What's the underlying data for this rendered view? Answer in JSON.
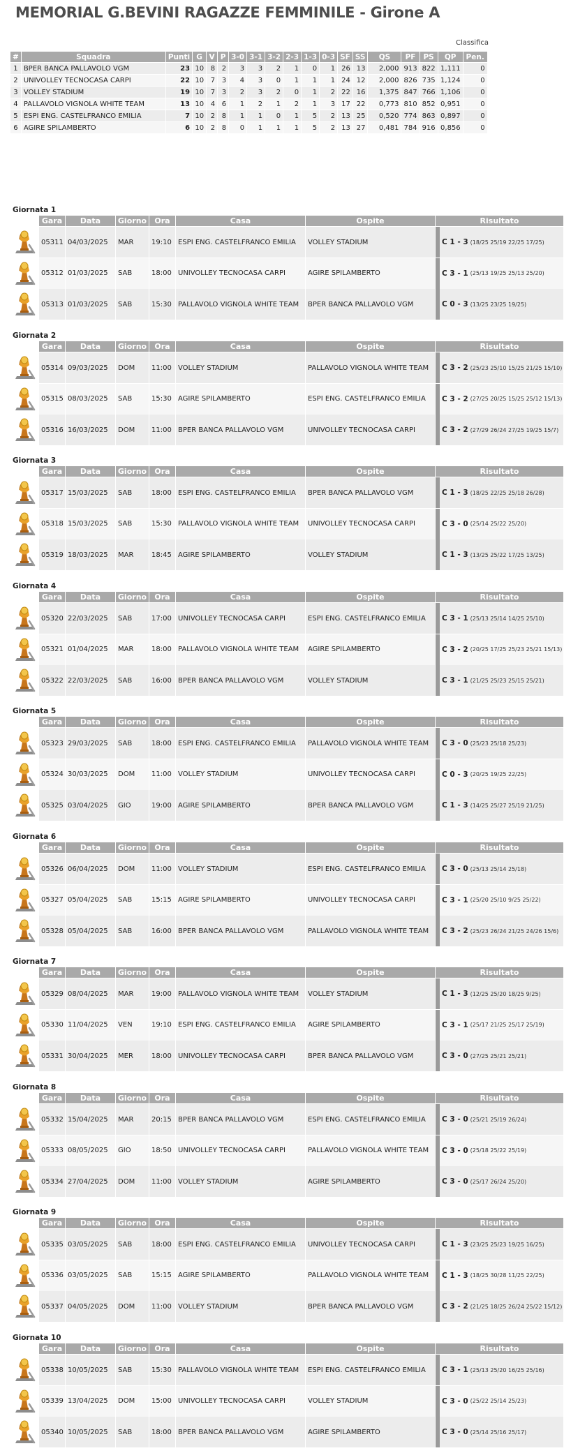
{
  "title": "MEMORIAL G.BEVINI RAGAZZE FEMMINILE - Girone A",
  "classifica": {
    "caption": "Classifica",
    "headers": [
      "#",
      "Squadra",
      "Punti",
      "G",
      "V",
      "P",
      "3-0",
      "3-1",
      "3-2",
      "2-3",
      "1-3",
      "0-3",
      "SF",
      "SS",
      "QS",
      "PF",
      "PS",
      "QP",
      "Pen."
    ],
    "rows": [
      [
        "1",
        "BPER BANCA PALLAVOLO VGM",
        "23",
        "10",
        "8",
        "2",
        "3",
        "3",
        "2",
        "1",
        "0",
        "1",
        "26",
        "13",
        "2,000",
        "913",
        "822",
        "1,111",
        "0"
      ],
      [
        "2",
        "UNIVOLLEY TECNOCASA CARPI",
        "22",
        "10",
        "7",
        "3",
        "4",
        "3",
        "0",
        "1",
        "1",
        "1",
        "24",
        "12",
        "2,000",
        "826",
        "735",
        "1,124",
        "0"
      ],
      [
        "3",
        "VOLLEY STADIUM",
        "19",
        "10",
        "7",
        "3",
        "2",
        "3",
        "2",
        "0",
        "1",
        "2",
        "22",
        "16",
        "1,375",
        "847",
        "766",
        "1,106",
        "0"
      ],
      [
        "4",
        "PALLAVOLO VIGNOLA WHITE TEAM",
        "13",
        "10",
        "4",
        "6",
        "1",
        "2",
        "1",
        "2",
        "1",
        "3",
        "17",
        "22",
        "0,773",
        "810",
        "852",
        "0,951",
        "0"
      ],
      [
        "5",
        "ESPI ENG. CASTELFRANCO EMILIA",
        "7",
        "10",
        "2",
        "8",
        "1",
        "1",
        "0",
        "1",
        "5",
        "2",
        "13",
        "25",
        "0,520",
        "774",
        "863",
        "0,897",
        "0"
      ],
      [
        "6",
        "AGIRE SPILAMBERTO",
        "6",
        "10",
        "2",
        "8",
        "0",
        "1",
        "1",
        "1",
        "5",
        "2",
        "13",
        "27",
        "0,481",
        "784",
        "916",
        "0,856",
        "0"
      ]
    ]
  },
  "round_headers": {
    "gara": "Gara",
    "data": "Data",
    "giorno": "Giorno",
    "ora": "Ora",
    "casa": "Casa",
    "ospite": "Ospite",
    "risultato": "Risultato"
  },
  "rounds": [
    {
      "title": "Giornata 1",
      "matches": [
        {
          "icon": "volleyball-trophy-icon",
          "gara": "05311",
          "data": "04/03/2025",
          "giorno": "MAR",
          "ora": "19:10",
          "casa": "ESPI ENG. CASTELFRANCO EMILIA",
          "ospite": "VOLLEY STADIUM",
          "score": "C 1 - 3",
          "sets": "(18/25 25/19 22/25 17/25)"
        },
        {
          "icon": "volleyball-trophy-icon",
          "gara": "05312",
          "data": "01/03/2025",
          "giorno": "SAB",
          "ora": "18:00",
          "casa": "UNIVOLLEY TECNOCASA CARPI",
          "ospite": "AGIRE SPILAMBERTO",
          "score": "C 3 - 1",
          "sets": "(25/13 19/25 25/13 25/20)"
        },
        {
          "icon": "volleyball-trophy-icon",
          "gara": "05313",
          "data": "01/03/2025",
          "giorno": "SAB",
          "ora": "15:30",
          "casa": "PALLAVOLO VIGNOLA WHITE TEAM",
          "ospite": "BPER BANCA PALLAVOLO VGM",
          "score": "C 0 - 3",
          "sets": "(13/25 23/25 19/25)"
        }
      ]
    },
    {
      "title": "Giornata 2",
      "matches": [
        {
          "icon": "volleyball-trophy-icon",
          "gara": "05314",
          "data": "09/03/2025",
          "giorno": "DOM",
          "ora": "11:00",
          "casa": "VOLLEY STADIUM",
          "ospite": "PALLAVOLO VIGNOLA WHITE TEAM",
          "score": "C 3 - 2",
          "sets": "(25/23 25/10 15/25 21/25 15/10)"
        },
        {
          "icon": "volleyball-trophy-icon",
          "gara": "05315",
          "data": "08/03/2025",
          "giorno": "SAB",
          "ora": "15:30",
          "casa": "AGIRE SPILAMBERTO",
          "ospite": "ESPI ENG. CASTELFRANCO EMILIA",
          "score": "C 3 - 2",
          "sets": "(27/25 20/25 15/25 25/12 15/13)"
        },
        {
          "icon": "volleyball-trophy-icon",
          "gara": "05316",
          "data": "16/03/2025",
          "giorno": "DOM",
          "ora": "11:00",
          "casa": "BPER BANCA PALLAVOLO VGM",
          "ospite": "UNIVOLLEY TECNOCASA CARPI",
          "score": "C 3 - 2",
          "sets": "(27/29 26/24 27/25 19/25 15/7)"
        }
      ]
    },
    {
      "title": "Giornata 3",
      "matches": [
        {
          "icon": "volleyball-trophy-icon",
          "gara": "05317",
          "data": "15/03/2025",
          "giorno": "SAB",
          "ora": "18:00",
          "casa": "ESPI ENG. CASTELFRANCO EMILIA",
          "ospite": "BPER BANCA PALLAVOLO VGM",
          "score": "C 1 - 3",
          "sets": "(18/25 22/25 25/18 26/28)"
        },
        {
          "icon": "volleyball-trophy-icon",
          "gara": "05318",
          "data": "15/03/2025",
          "giorno": "SAB",
          "ora": "15:30",
          "casa": "PALLAVOLO VIGNOLA WHITE TEAM",
          "ospite": "UNIVOLLEY TECNOCASA CARPI",
          "score": "C 3 - 0",
          "sets": "(25/14 25/22 25/20)"
        },
        {
          "icon": "volleyball-trophy-icon",
          "gara": "05319",
          "data": "18/03/2025",
          "giorno": "MAR",
          "ora": "18:45",
          "casa": "AGIRE SPILAMBERTO",
          "ospite": "VOLLEY STADIUM",
          "score": "C 1 - 3",
          "sets": "(13/25 25/22 17/25 13/25)"
        }
      ]
    },
    {
      "title": "Giornata 4",
      "matches": [
        {
          "icon": "volleyball-trophy-icon",
          "gara": "05320",
          "data": "22/03/2025",
          "giorno": "SAB",
          "ora": "17:00",
          "casa": "UNIVOLLEY TECNOCASA CARPI",
          "ospite": "ESPI ENG. CASTELFRANCO EMILIA",
          "score": "C 3 - 1",
          "sets": "(25/13 25/14 14/25 25/10)"
        },
        {
          "icon": "volleyball-trophy-icon",
          "gara": "05321",
          "data": "01/04/2025",
          "giorno": "MAR",
          "ora": "18:00",
          "casa": "PALLAVOLO VIGNOLA WHITE TEAM",
          "ospite": "AGIRE SPILAMBERTO",
          "score": "C 3 - 2",
          "sets": "(20/25 17/25 25/23 25/21 15/13)"
        },
        {
          "icon": "volleyball-trophy-icon",
          "gara": "05322",
          "data": "22/03/2025",
          "giorno": "SAB",
          "ora": "16:00",
          "casa": "BPER BANCA PALLAVOLO VGM",
          "ospite": "VOLLEY STADIUM",
          "score": "C 3 - 1",
          "sets": "(21/25 25/23 25/15 25/21)"
        }
      ]
    },
    {
      "title": "Giornata 5",
      "matches": [
        {
          "icon": "volleyball-trophy-icon",
          "gara": "05323",
          "data": "29/03/2025",
          "giorno": "SAB",
          "ora": "18:00",
          "casa": "ESPI ENG. CASTELFRANCO EMILIA",
          "ospite": "PALLAVOLO VIGNOLA WHITE TEAM",
          "score": "C 3 - 0",
          "sets": "(25/23 25/18 25/23)"
        },
        {
          "icon": "volleyball-trophy-icon",
          "gara": "05324",
          "data": "30/03/2025",
          "giorno": "DOM",
          "ora": "11:00",
          "casa": "VOLLEY STADIUM",
          "ospite": "UNIVOLLEY TECNOCASA CARPI",
          "score": "C 0 - 3",
          "sets": "(20/25 19/25 22/25)"
        },
        {
          "icon": "volleyball-trophy-icon",
          "gara": "05325",
          "data": "03/04/2025",
          "giorno": "GIO",
          "ora": "19:00",
          "casa": "AGIRE SPILAMBERTO",
          "ospite": "BPER BANCA PALLAVOLO VGM",
          "score": "C 1 - 3",
          "sets": "(14/25 25/27 25/19 21/25)"
        }
      ]
    },
    {
      "title": "Giornata 6",
      "matches": [
        {
          "icon": "volleyball-trophy-icon",
          "gara": "05326",
          "data": "06/04/2025",
          "giorno": "DOM",
          "ora": "11:00",
          "casa": "VOLLEY STADIUM",
          "ospite": "ESPI ENG. CASTELFRANCO EMILIA",
          "score": "C 3 - 0",
          "sets": "(25/13 25/14 25/18)"
        },
        {
          "icon": "volleyball-trophy-icon",
          "gara": "05327",
          "data": "05/04/2025",
          "giorno": "SAB",
          "ora": "15:15",
          "casa": "AGIRE SPILAMBERTO",
          "ospite": "UNIVOLLEY TECNOCASA CARPI",
          "score": "C 3 - 1",
          "sets": "(25/20 25/10 9/25 25/22)"
        },
        {
          "icon": "volleyball-trophy-icon",
          "gara": "05328",
          "data": "05/04/2025",
          "giorno": "SAB",
          "ora": "16:00",
          "casa": "BPER BANCA PALLAVOLO VGM",
          "ospite": "PALLAVOLO VIGNOLA WHITE TEAM",
          "score": "C 3 - 2",
          "sets": "(25/23 26/24 21/25 24/26 15/6)"
        }
      ]
    },
    {
      "title": "Giornata 7",
      "matches": [
        {
          "icon": "volleyball-trophy-icon",
          "gara": "05329",
          "data": "08/04/2025",
          "giorno": "MAR",
          "ora": "19:00",
          "casa": "PALLAVOLO VIGNOLA WHITE TEAM",
          "ospite": "VOLLEY STADIUM",
          "score": "C 1 - 3",
          "sets": "(12/25 25/20 18/25 9/25)"
        },
        {
          "icon": "volleyball-trophy-icon",
          "gara": "05330",
          "data": "11/04/2025",
          "giorno": "VEN",
          "ora": "19:10",
          "casa": "ESPI ENG. CASTELFRANCO EMILIA",
          "ospite": "AGIRE SPILAMBERTO",
          "score": "C 3 - 1",
          "sets": "(25/17 21/25 25/17 25/19)"
        },
        {
          "icon": "volleyball-trophy-icon",
          "gara": "05331",
          "data": "30/04/2025",
          "giorno": "MER",
          "ora": "18:00",
          "casa": "UNIVOLLEY TECNOCASA CARPI",
          "ospite": "BPER BANCA PALLAVOLO VGM",
          "score": "C 3 - 0",
          "sets": "(27/25 25/21 25/21)"
        }
      ]
    },
    {
      "title": "Giornata 8",
      "matches": [
        {
          "icon": "volleyball-trophy-icon",
          "gara": "05332",
          "data": "15/04/2025",
          "giorno": "MAR",
          "ora": "20:15",
          "casa": "BPER BANCA PALLAVOLO VGM",
          "ospite": "ESPI ENG. CASTELFRANCO EMILIA",
          "score": "C 3 - 0",
          "sets": "(25/21 25/19 26/24)"
        },
        {
          "icon": "volleyball-trophy-icon",
          "gara": "05333",
          "data": "08/05/2025",
          "giorno": "GIO",
          "ora": "18:50",
          "casa": "UNIVOLLEY TECNOCASA CARPI",
          "ospite": "PALLAVOLO VIGNOLA WHITE TEAM",
          "score": "C 3 - 0",
          "sets": "(25/18 25/22 25/19)"
        },
        {
          "icon": "volleyball-trophy-icon",
          "gara": "05334",
          "data": "27/04/2025",
          "giorno": "DOM",
          "ora": "11:00",
          "casa": "VOLLEY STADIUM",
          "ospite": "AGIRE SPILAMBERTO",
          "score": "C 3 - 0",
          "sets": "(25/17 26/24 25/20)"
        }
      ]
    },
    {
      "title": "Giornata 9",
      "matches": [
        {
          "icon": "volleyball-trophy-icon",
          "gara": "05335",
          "data": "03/05/2025",
          "giorno": "SAB",
          "ora": "18:00",
          "casa": "ESPI ENG. CASTELFRANCO EMILIA",
          "ospite": "UNIVOLLEY TECNOCASA CARPI",
          "score": "C 1 - 3",
          "sets": "(23/25 25/23 19/25 16/25)"
        },
        {
          "icon": "volleyball-trophy-icon",
          "gara": "05336",
          "data": "03/05/2025",
          "giorno": "SAB",
          "ora": "15:15",
          "casa": "AGIRE SPILAMBERTO",
          "ospite": "PALLAVOLO VIGNOLA WHITE TEAM",
          "score": "C 1 - 3",
          "sets": "(18/25 30/28 11/25 22/25)"
        },
        {
          "icon": "volleyball-trophy-icon",
          "gara": "05337",
          "data": "04/05/2025",
          "giorno": "DOM",
          "ora": "11:00",
          "casa": "VOLLEY STADIUM",
          "ospite": "BPER BANCA PALLAVOLO VGM",
          "score": "C 3 - 2",
          "sets": "(21/25 18/25 26/24 25/22 15/12)"
        }
      ]
    },
    {
      "title": "Giornata 10",
      "matches": [
        {
          "icon": "volleyball-trophy-icon",
          "gara": "05338",
          "data": "10/05/2025",
          "giorno": "SAB",
          "ora": "15:30",
          "casa": "PALLAVOLO VIGNOLA WHITE TEAM",
          "ospite": "ESPI ENG. CASTELFRANCO EMILIA",
          "score": "C 3 - 1",
          "sets": "(25/13 25/20 16/25 25/16)"
        },
        {
          "icon": "volleyball-trophy-icon",
          "gara": "05339",
          "data": "13/04/2025",
          "giorno": "DOM",
          "ora": "15:00",
          "casa": "UNIVOLLEY TECNOCASA CARPI",
          "ospite": "VOLLEY STADIUM",
          "score": "C 3 - 0",
          "sets": "(25/22 25/14 25/23)"
        },
        {
          "icon": "volleyball-trophy-icon",
          "gara": "05340",
          "data": "10/05/2025",
          "giorno": "SAB",
          "ora": "18:00",
          "casa": "BPER BANCA PALLAVOLO VGM",
          "ospite": "AGIRE SPILAMBERTO",
          "score": "C 3 - 0",
          "sets": "(25/14 25/16 25/17)"
        }
      ]
    }
  ]
}
